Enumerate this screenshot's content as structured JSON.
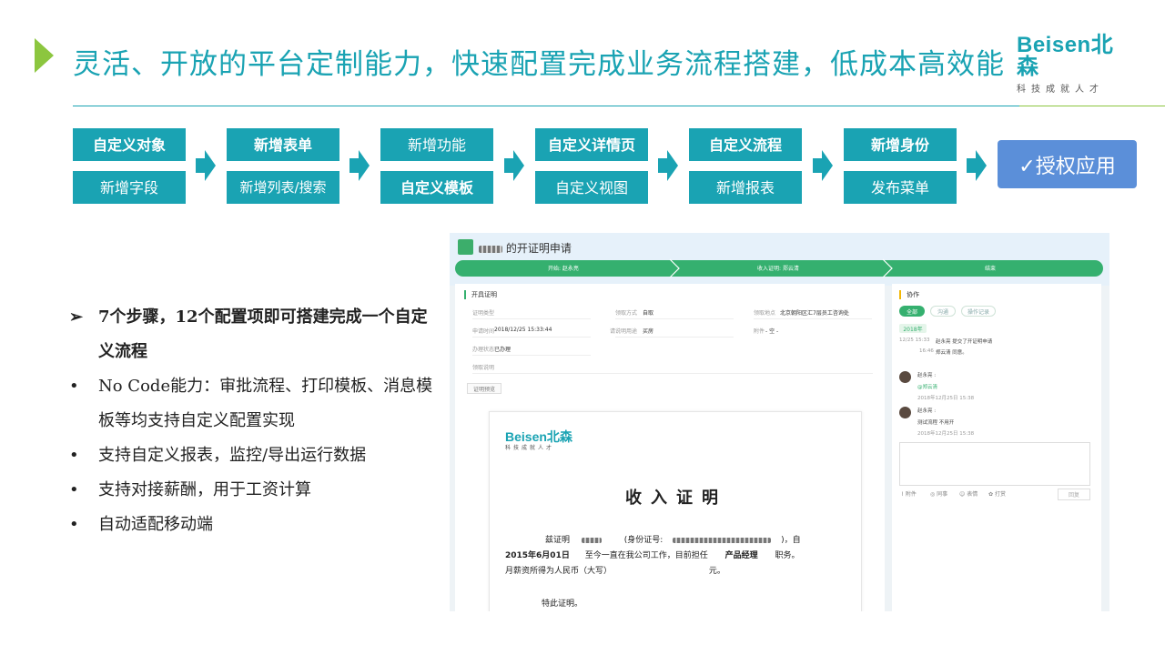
{
  "header": {
    "title": "灵活、开放的平台定制能力，快速配置完成业务流程搭建，低成本高效能",
    "logo": "Beisen北森",
    "logo_sub": "科技成就人才"
  },
  "flow": {
    "columns": [
      {
        "top": "自定义对象",
        "bottom": "新增字段"
      },
      {
        "top": "新增表单",
        "bottom": "新增列表/搜索"
      },
      {
        "top": "新增功能",
        "bottom": "自定义模板"
      },
      {
        "top": "自定义详情页",
        "bottom": "自定义视图"
      },
      {
        "top": "自定义流程",
        "bottom": "新增报表"
      },
      {
        "top": "新增身份",
        "bottom": "发布菜单"
      }
    ],
    "final": "✓授权应用"
  },
  "bullets": [
    {
      "mark": "➢",
      "text": "7个步骤，12个配置项即可搭建完成一个自定义流程"
    },
    {
      "mark": "•",
      "text": "No Code能力：审批流程、打印模板、消息模板等均支持自定义配置实现"
    },
    {
      "mark": "•",
      "text": "支持自定义报表，监控/导出运行数据"
    },
    {
      "mark": "•",
      "text": "支持对接薪酬，用于工资计算"
    },
    {
      "mark": "•",
      "text": "自动适配移动端"
    }
  ],
  "screenshot": {
    "title": "的开证明申请",
    "flow_steps": [
      "开始: 赵永亮",
      "收入证明: 郑云清",
      "结束"
    ],
    "form_title": "开具证明",
    "fields": {
      "cert_type_label": "证明类型",
      "pickup_label": "领取方式",
      "pickup_value": "自取",
      "place_label": "领取地点",
      "place_value": "北京朝阳区汇7层员工咨询处",
      "apply_time_label": "申请时间",
      "apply_time_value": "2018/12/25 15:33:44",
      "purpose_label": "请说明用途",
      "purpose_value": "买房",
      "attach_label": "附件",
      "attach_value": "- 空 -",
      "status_label": "办理状态",
      "status_value": "已办理",
      "pickup_note_label": "领取说明"
    },
    "preview_button": "证明预览",
    "paper": {
      "logo": "Beisen北森",
      "logo_sub": "科技成就人才",
      "title": "收入证明",
      "line1_a": "兹证明",
      "line1_b": "(身份证号:",
      "line1_c": ")，自",
      "line2_date": "2015年6月01日",
      "line2_mid": "至今一直在我公司工作，目前担任",
      "line2_pos": "产品经理",
      "line2_end": "职务。",
      "line3_a": "月薪资所得为人民币（大写）",
      "line3_b": "元。",
      "line4": "特此证明。"
    },
    "side": {
      "title": "协作",
      "tabs": [
        "全部",
        "沟通",
        "操作记录"
      ],
      "year": "2018年",
      "log1_time": "12/25 15:33",
      "log1_text": "赵永亮 提交了开证明申请",
      "log2_time": "16:46",
      "log2_text": "郑云清 同意。",
      "c1_name": "赵永亮 :",
      "c1_text": "@郑云清",
      "c1_time": "2018年12月25日 15:38",
      "c2_name": "赵永亮 :",
      "c2_text": "测试流程 不用开",
      "c2_time": "2018年12月25日 15:38",
      "tools": [
        "附件",
        "同事",
        "表情",
        "打赏"
      ],
      "reply": "回复"
    }
  }
}
